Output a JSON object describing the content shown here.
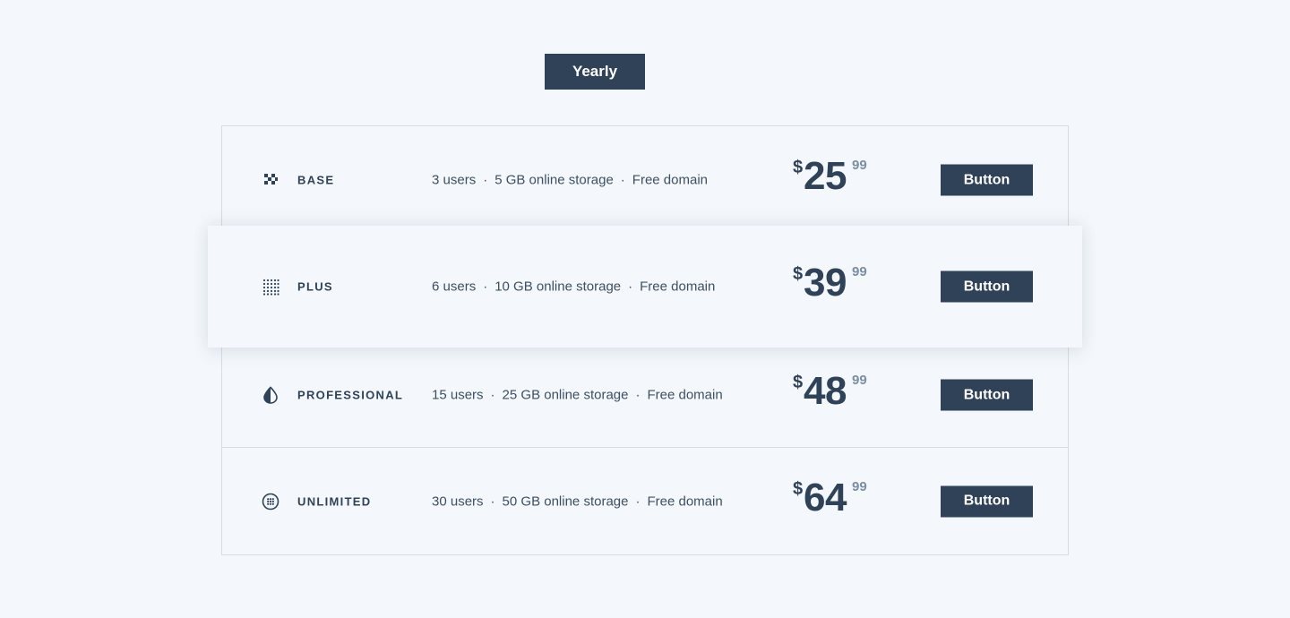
{
  "billing_toggle": {
    "label": "Yearly"
  },
  "plans": [
    {
      "icon": "checker-icon",
      "name": "BASE",
      "features": [
        "3 users",
        "5 GB online storage",
        "Free domain"
      ],
      "currency": "$",
      "price_whole": "25",
      "price_cents": "99",
      "button_label": "Button"
    },
    {
      "icon": "dot-grid-icon",
      "name": "PLUS",
      "features": [
        "6 users",
        "10 GB online storage",
        "Free domain"
      ],
      "currency": "$",
      "price_whole": "39",
      "price_cents": "99",
      "button_label": "Button"
    },
    {
      "icon": "half-drop-icon",
      "name": "PROFESSIONAL",
      "features": [
        "15 users",
        "25 GB online storage",
        "Free domain"
      ],
      "currency": "$",
      "price_whole": "48",
      "price_cents": "99",
      "button_label": "Button"
    },
    {
      "icon": "circle-dots-icon",
      "name": "UNLIMITED",
      "features": [
        "30 users",
        "50 GB online storage",
        "Free domain"
      ],
      "currency": "$",
      "price_whole": "64",
      "price_cents": "99",
      "button_label": "Button"
    }
  ],
  "colors": {
    "background": "#f4f8fc",
    "primary": "#2f4257",
    "muted": "#7c8ea2",
    "border": "#d6dde5"
  }
}
